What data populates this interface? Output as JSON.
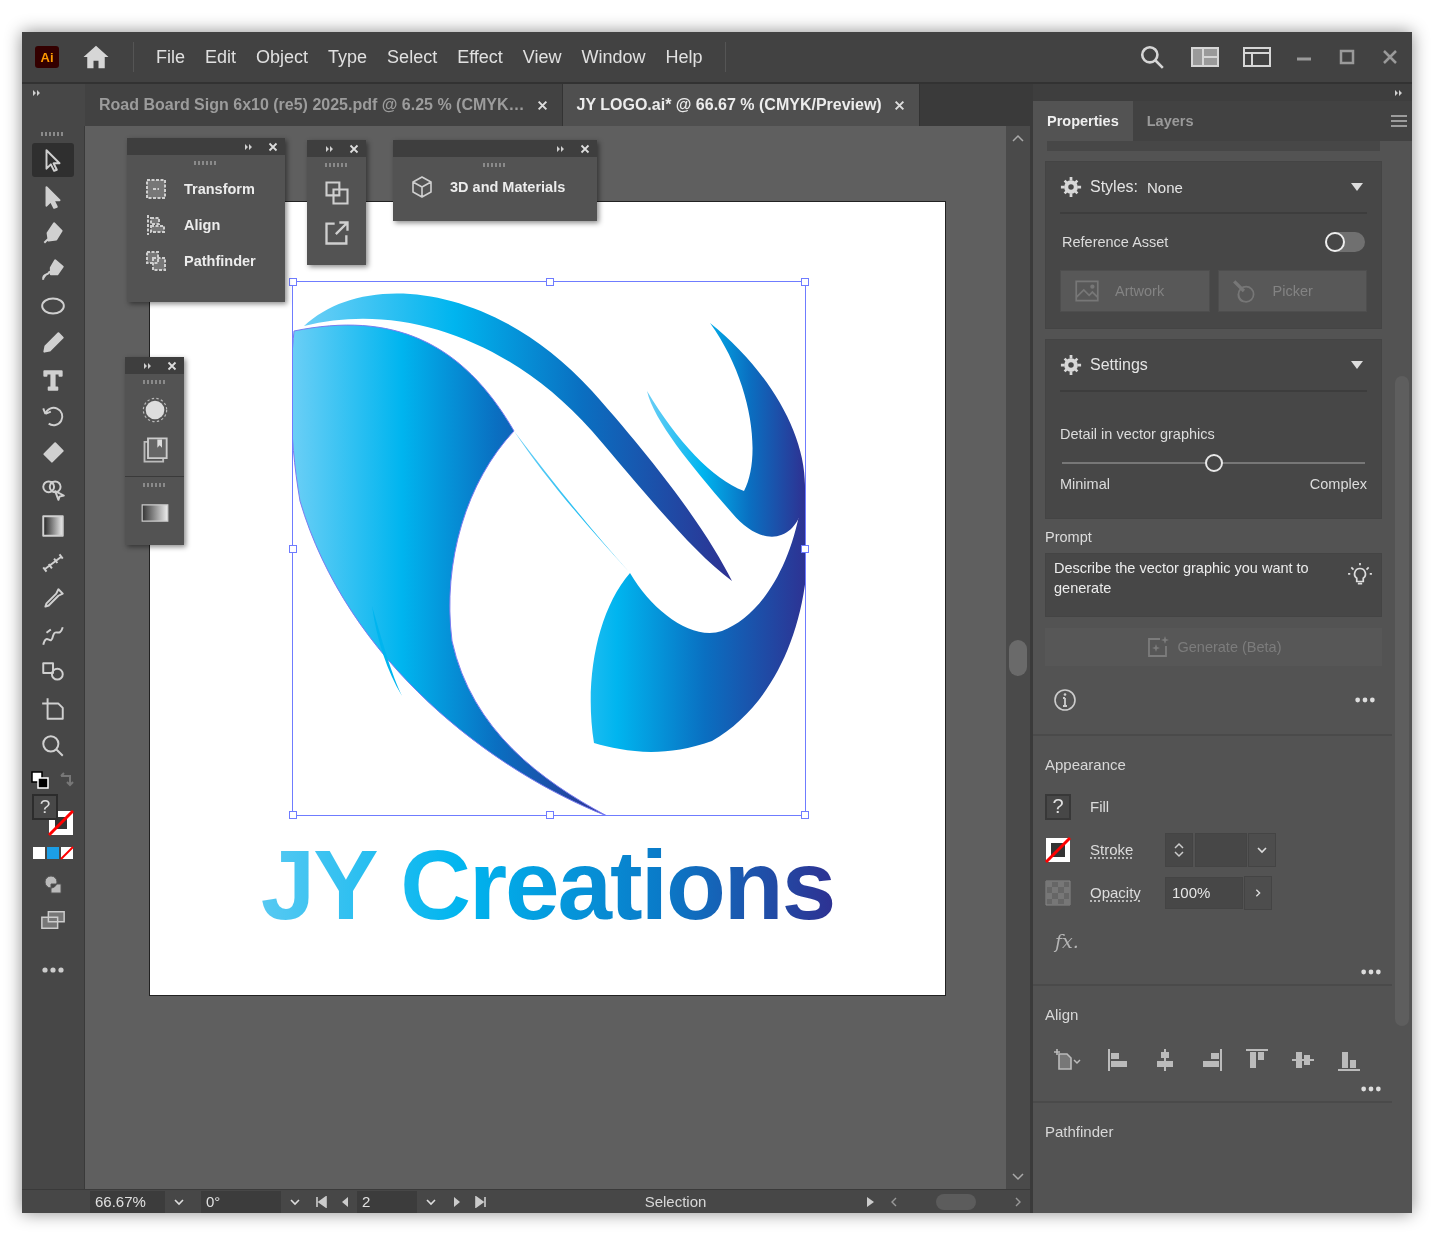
{
  "app": {
    "logo": "Ai"
  },
  "menu": [
    "File",
    "Edit",
    "Object",
    "Type",
    "Select",
    "Effect",
    "View",
    "Window",
    "Help"
  ],
  "document_tabs": [
    {
      "title": "Road Board Sign 6x10 (re5) 2025.pdf @ 6.25 % (CMYK…",
      "selected": false
    },
    {
      "title": "JY LOGO.ai* @ 66.67 % (CMYK/Preview)",
      "selected": true
    }
  ],
  "tools": [
    {
      "kind": "selection",
      "selected": true
    },
    {
      "kind": "direct-selection",
      "selected": false
    },
    {
      "kind": "pen",
      "selected": false
    },
    {
      "kind": "curvature",
      "selected": false
    },
    {
      "kind": "ellipse",
      "selected": false
    },
    {
      "kind": "pencil",
      "selected": false
    },
    {
      "kind": "type",
      "selected": false
    },
    {
      "kind": "rotate",
      "selected": false
    },
    {
      "kind": "eraser",
      "selected": false
    },
    {
      "kind": "shape-builder",
      "selected": false
    },
    {
      "kind": "gradient",
      "selected": false
    },
    {
      "kind": "width",
      "selected": false
    },
    {
      "kind": "eyedropper",
      "selected": false
    },
    {
      "kind": "blend",
      "selected": false
    },
    {
      "kind": "live-paint",
      "selected": false
    },
    {
      "kind": "artboard",
      "selected": false
    },
    {
      "kind": "zoom",
      "selected": false
    }
  ],
  "fill_indicator": "?",
  "floating_panels": [
    {
      "items": [
        {
          "kind": "transform",
          "label": "Transform"
        },
        {
          "kind": "align",
          "label": "Align"
        },
        {
          "kind": "pathfinder",
          "label": "Pathfinder"
        }
      ]
    },
    {
      "items": [
        {
          "kind": "cube",
          "label": "3D and Materials"
        }
      ]
    }
  ],
  "artboard": {
    "wordmark": "JY Creations"
  },
  "properties_panel": {
    "tabs": [
      {
        "label": "Properties",
        "selected": true
      },
      {
        "label": "Layers",
        "selected": false
      }
    ],
    "styles": {
      "label": "Styles:",
      "value": "None"
    },
    "reference_asset": {
      "label": "Reference Asset",
      "on": false
    },
    "asset_buttons": [
      {
        "kind": "artwork",
        "label": "Artwork",
        "disabled": true
      },
      {
        "kind": "picker",
        "label": "Picker",
        "disabled": true
      }
    ],
    "settings": {
      "title": "Settings",
      "slider_label": "Detail in vector graphics",
      "level": 0.5,
      "min_label": "Minimal",
      "max_label": "Complex"
    },
    "prompt": {
      "label": "Prompt",
      "placeholder": "Describe the vector graphic you want to generate"
    },
    "generate": {
      "label": "Generate (Beta)",
      "disabled": true
    },
    "appearance": {
      "title": "Appearance",
      "fill_swatch": "?",
      "fill": "Fill",
      "stroke": "Stroke",
      "opacity": "Opacity",
      "opacity_value": "100%",
      "effects": "fx."
    },
    "align": {
      "title": "Align"
    },
    "pathfinder": {
      "title": "Pathfinder"
    }
  },
  "status_bar": {
    "zoom": "66.67%",
    "rotation": "0°",
    "artboard": "2",
    "current_tool": "Selection"
  }
}
